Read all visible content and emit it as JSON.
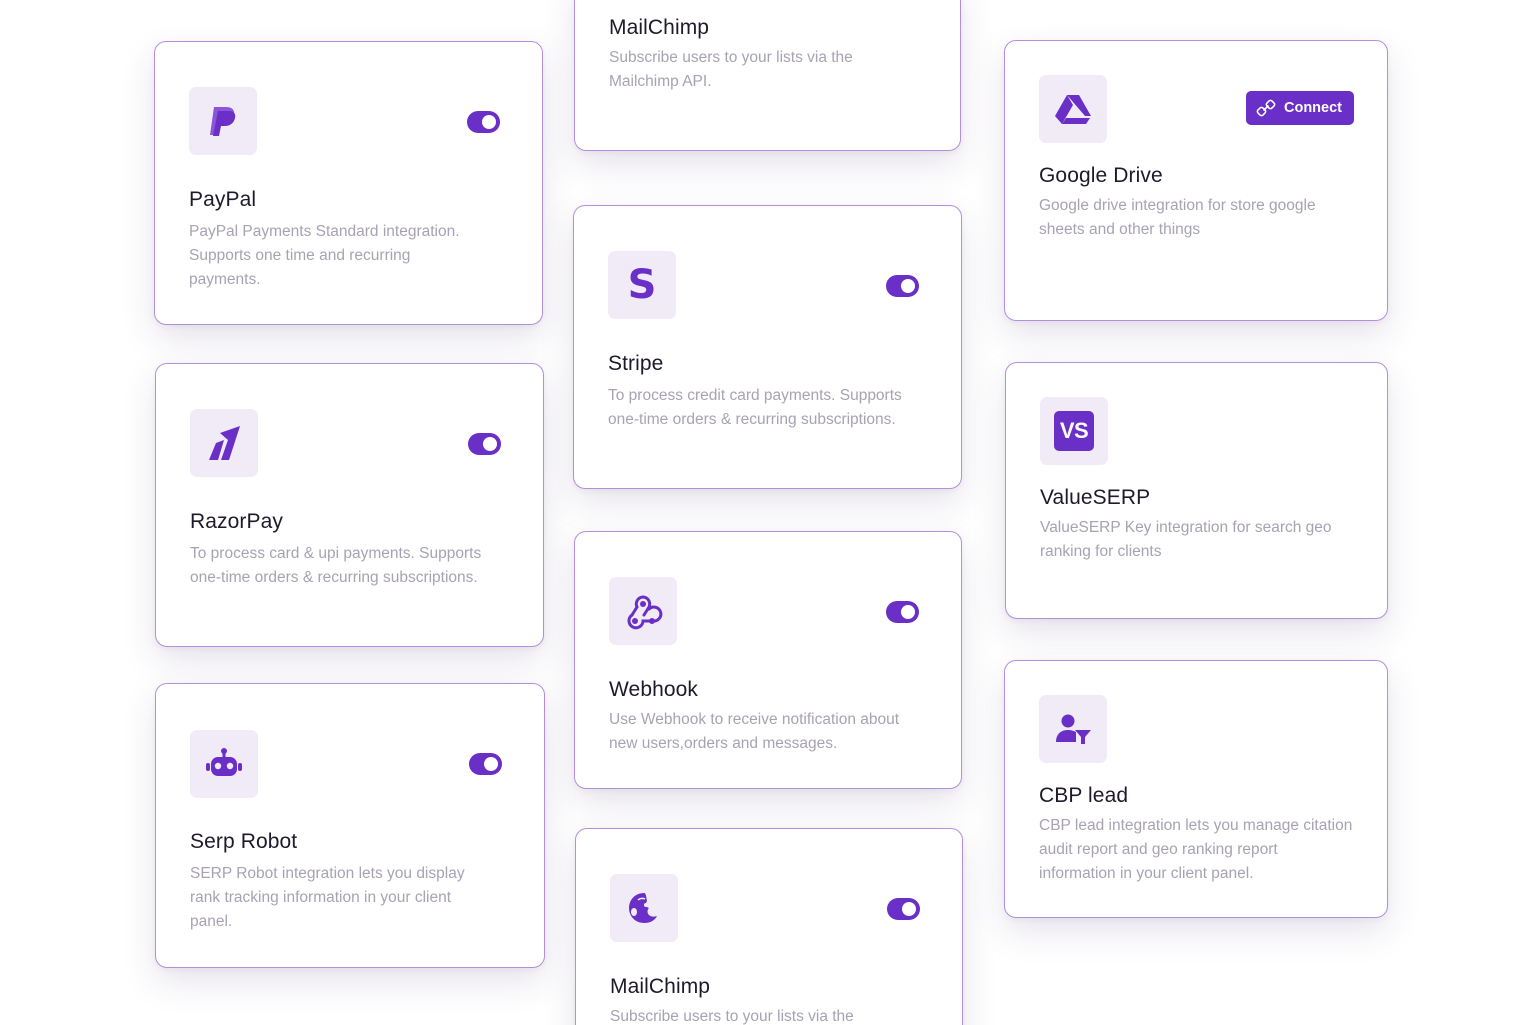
{
  "colors": {
    "accent": "#6a2fc6",
    "tile": "#f1ebf8",
    "border": "#b38fe0",
    "title": "#1f1a2b",
    "muted": "#a8a2b2"
  },
  "cards": {
    "mailchimp_top": {
      "title": "MailChimp",
      "description": "Subscribe users to your lists via the Mailchimp API."
    },
    "paypal": {
      "title": "PayPal",
      "description": "PayPal Payments Standard integration. Supports one time and recurring payments.",
      "icon": "paypal-icon",
      "enabled": true
    },
    "stripe": {
      "title": "Stripe",
      "description": "To process credit card payments. Supports one-time orders & recurring subscriptions.",
      "icon": "stripe-icon",
      "icon_glyph": "S",
      "enabled": true
    },
    "google_drive": {
      "title": "Google Drive",
      "description": "Google drive integration for store google sheets and other things",
      "icon": "google-drive-icon",
      "connect_label": "Connect"
    },
    "razorpay": {
      "title": "RazorPay",
      "description": "To process card & upi payments. Supports one-time orders & recurring subscriptions.",
      "icon": "razorpay-icon",
      "enabled": true
    },
    "valueserp": {
      "title": "ValueSERP",
      "description": "ValueSERP Key integration for search geo ranking for clients",
      "icon": "valueserp-icon",
      "badge": "VS"
    },
    "webhook": {
      "title": "Webhook",
      "description": "Use Webhook to receive notification about new users,orders and messages.",
      "icon": "webhook-icon",
      "enabled": true
    },
    "serp_robot": {
      "title": "Serp Robot",
      "description": "SERP Robot integration lets you display rank tracking information in your client panel.",
      "icon": "robot-icon",
      "enabled": true
    },
    "cbp_lead": {
      "title": "CBP lead",
      "description": "CBP lead integration lets you manage citation audit report and geo ranking report information in your client panel.",
      "icon": "user-filter-icon"
    },
    "mailchimp_bottom": {
      "title": "MailChimp",
      "description": "Subscribe users to your lists via the",
      "icon": "mailchimp-icon",
      "enabled": true
    }
  }
}
